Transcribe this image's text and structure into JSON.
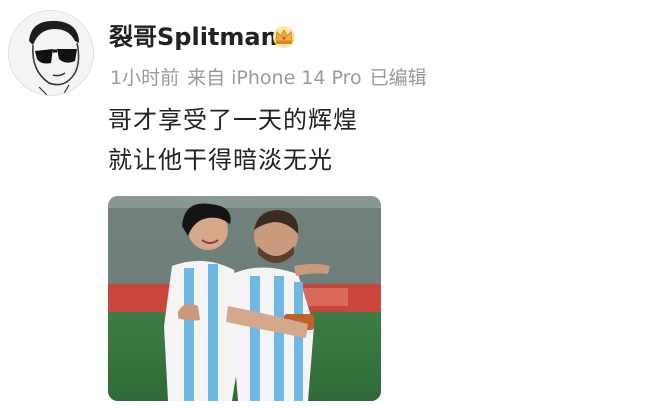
{
  "post": {
    "username": "裂哥Splitman",
    "badge_icon": "crown-icon",
    "time": "1小时前",
    "source": "来自 iPhone 14 Pro",
    "edited": "已编辑",
    "lines": [
      "哥才享受了一天的辉煌",
      "就让他干得暗淡无光"
    ],
    "avatar_icon": "sunglasses-cartoon-avatar",
    "photo_subject": "two-players-hugging-photo"
  },
  "colors": {
    "name": "#222222",
    "meta": "#9a9a9a",
    "text": "#222222",
    "crown": "#f2b13c",
    "jersey_blue": "#6fb8e6"
  }
}
